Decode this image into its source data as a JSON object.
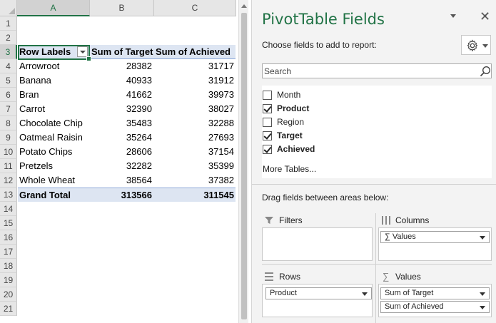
{
  "sheet": {
    "columns": [
      "A",
      "B",
      "C"
    ],
    "row_numbers": [
      "1",
      "2",
      "3",
      "4",
      "5",
      "6",
      "7",
      "8",
      "9",
      "10",
      "11",
      "12",
      "13",
      "14",
      "15",
      "16",
      "17",
      "18",
      "19",
      "20",
      "21"
    ],
    "header": {
      "row_labels": "Row Labels",
      "target": "Sum of Target",
      "achieved": "Sum of Achieved"
    },
    "rows": [
      {
        "label": "Arrowroot",
        "target": "28382",
        "achieved": "31717"
      },
      {
        "label": "Banana",
        "target": "40933",
        "achieved": "31912"
      },
      {
        "label": "Bran",
        "target": "41662",
        "achieved": "39973"
      },
      {
        "label": "Carrot",
        "target": "32390",
        "achieved": "38027"
      },
      {
        "label": "Chocolate Chip",
        "target": "35483",
        "achieved": "32288"
      },
      {
        "label": "Oatmeal Raisin",
        "target": "35264",
        "achieved": "27693"
      },
      {
        "label": "Potato Chips",
        "target": "28606",
        "achieved": "37154"
      },
      {
        "label": "Pretzels",
        "target": "32282",
        "achieved": "35399"
      },
      {
        "label": "Whole Wheat",
        "target": "38564",
        "achieved": "37382"
      }
    ],
    "grand_total": {
      "label": "Grand Total",
      "target": "313566",
      "achieved": "311545"
    }
  },
  "pane": {
    "title": "PivotTable Fields",
    "choose_label": "Choose fields to add to report:",
    "search_placeholder": "Search",
    "fields": [
      {
        "label": "Month",
        "checked": false
      },
      {
        "label": "Product",
        "checked": true
      },
      {
        "label": "Region",
        "checked": false
      },
      {
        "label": "Target",
        "checked": true
      },
      {
        "label": "Achieved",
        "checked": true
      }
    ],
    "more_tables": "More Tables...",
    "drag_hint": "Drag fields between areas below:",
    "areas": {
      "filters": {
        "title": "Filters"
      },
      "columns": {
        "title": "Columns",
        "items": [
          "Values"
        ]
      },
      "rows": {
        "title": "Rows",
        "items": [
          "Product"
        ]
      },
      "values": {
        "title": "Values",
        "items": [
          "Sum of Target",
          "Sum of Achieved"
        ]
      }
    }
  },
  "icons": [
    "gear-icon",
    "search-icon",
    "close-icon",
    "filter-icon",
    "columns-icon",
    "rows-icon",
    "sigma-icon",
    "dropdown-arrow-icon"
  ],
  "colors": {
    "accent": "#217346",
    "pivot_header_fill": "#dde5f2"
  }
}
